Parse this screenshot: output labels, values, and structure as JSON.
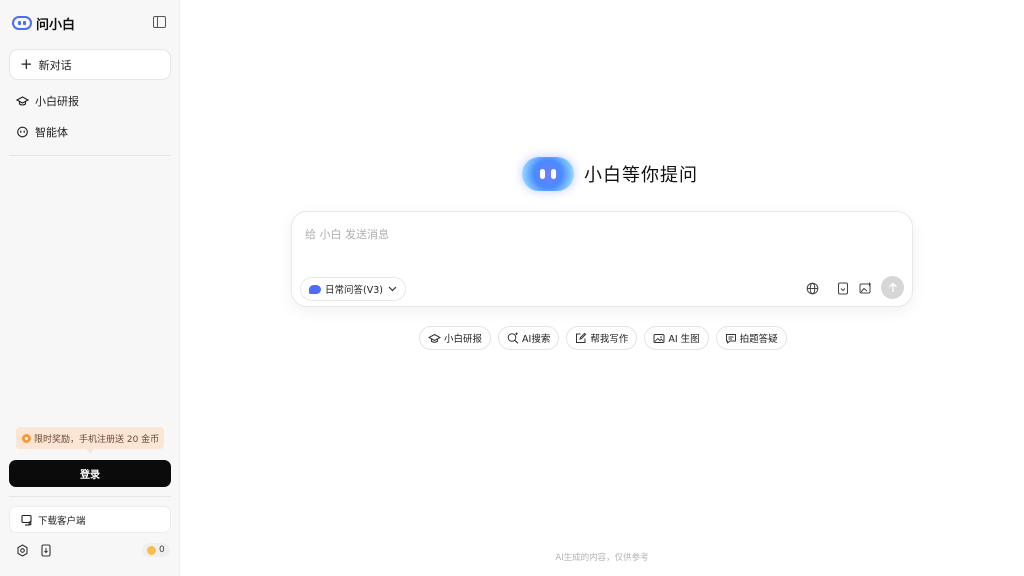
{
  "sidebar": {
    "brand": "问小白",
    "new_chat_label": "新对话",
    "nav": [
      {
        "label": "小白研报",
        "icon": "graduation-cap-icon"
      },
      {
        "label": "智能体",
        "icon": "robot-face-icon"
      }
    ],
    "promo_text": "限时奖励，手机注册送 20 金币",
    "login_label": "登录",
    "download_label": "下载客户端",
    "coin_count": "0"
  },
  "main": {
    "hero_title": "小白等你提问",
    "input_placeholder": "给 小白 发送消息",
    "model_label": "日常问答(V3)",
    "chips": [
      {
        "label": "小白研报",
        "icon": "graduation-cap-icon"
      },
      {
        "label": "AI搜索",
        "icon": "search-sparkle-icon"
      },
      {
        "label": "帮我写作",
        "icon": "edit-icon"
      },
      {
        "label": "AI 生图",
        "icon": "image-icon"
      },
      {
        "label": "拍题答疑",
        "icon": "chat-bubble-icon"
      }
    ],
    "footer_note": "AI生成的内容，仅供参考"
  },
  "colors": {
    "accent": "#4a6cf7",
    "login_bg": "#0b0b0b",
    "promo_bg": "#fbe6d6",
    "sidebar_bg": "#f7f7f8"
  }
}
